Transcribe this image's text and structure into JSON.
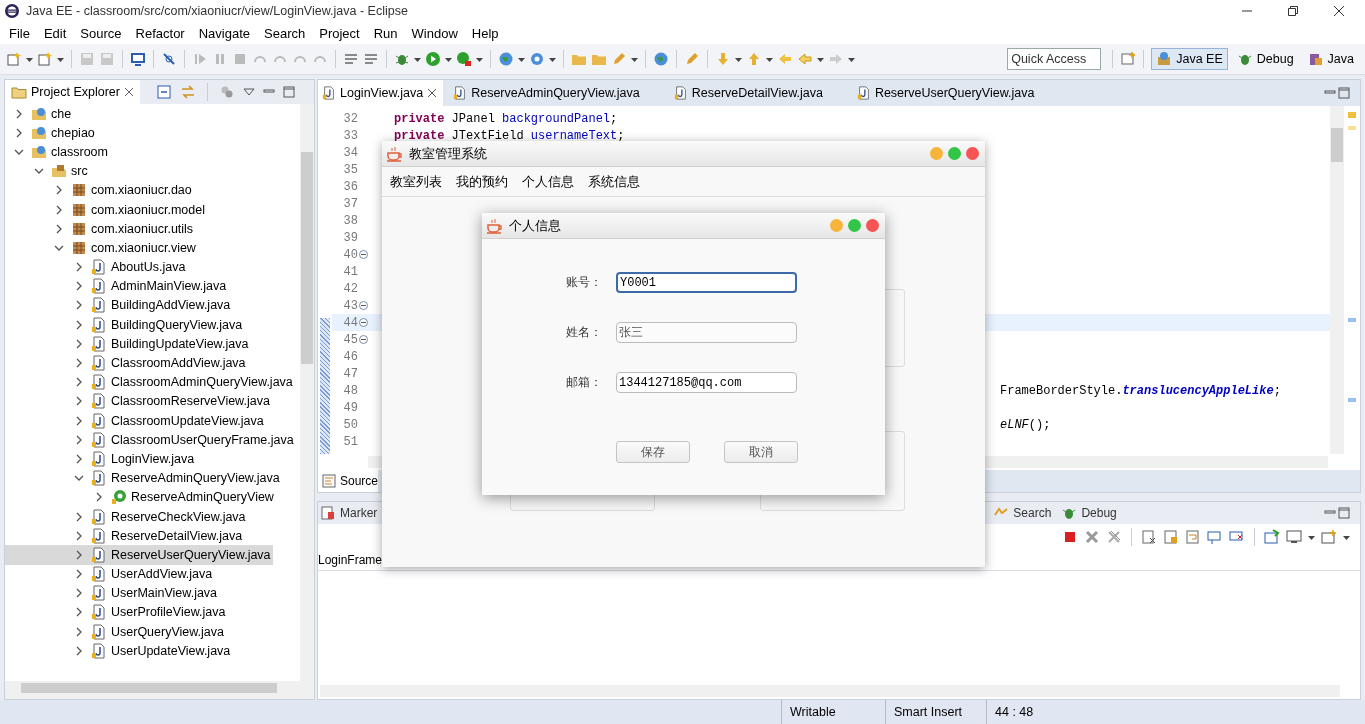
{
  "window": {
    "title": "Java EE - classroom/src/com/xiaoniucr/view/LoginView.java - Eclipse"
  },
  "menu": [
    "File",
    "Edit",
    "Source",
    "Refactor",
    "Navigate",
    "Search",
    "Project",
    "Run",
    "Window",
    "Help"
  ],
  "quick_access": {
    "placeholder": "Quick Access"
  },
  "perspectives": [
    {
      "label": "Java EE",
      "kind": "javaee",
      "selected": true
    },
    {
      "label": "Debug",
      "kind": "debug",
      "selected": false
    },
    {
      "label": "Java",
      "kind": "java",
      "selected": false
    }
  ],
  "project_explorer": {
    "title": "Project Explorer",
    "tree": [
      {
        "label": "che",
        "kind": "project",
        "expanded": false,
        "selected": false
      },
      {
        "label": "chepiao",
        "kind": "project",
        "expanded": false,
        "selected": false
      },
      {
        "label": "classroom",
        "kind": "project",
        "expanded": true,
        "selected": false,
        "children": [
          {
            "label": "src",
            "kind": "folder",
            "expanded": true,
            "selected": false,
            "children": [
              {
                "label": "com.xiaoniucr.dao",
                "kind": "package",
                "expanded": false,
                "selected": false
              },
              {
                "label": "com.xiaoniucr.model",
                "kind": "package",
                "expanded": false,
                "selected": false
              },
              {
                "label": "com.xiaoniucr.utils",
                "kind": "package",
                "expanded": false,
                "selected": false
              },
              {
                "label": "com.xiaoniucr.view",
                "kind": "package",
                "expanded": true,
                "selected": false,
                "children": [
                  {
                    "label": "AboutUs.java",
                    "kind": "file",
                    "expanded": false,
                    "selected": false
                  },
                  {
                    "label": "AdminMainView.java",
                    "kind": "file",
                    "expanded": false,
                    "selected": false
                  },
                  {
                    "label": "BuildingAddView.java",
                    "kind": "file",
                    "expanded": false,
                    "selected": false
                  },
                  {
                    "label": "BuildingQueryView.java",
                    "kind": "file",
                    "expanded": false,
                    "selected": false
                  },
                  {
                    "label": "BuildingUpdateView.java",
                    "kind": "file",
                    "expanded": false,
                    "selected": false
                  },
                  {
                    "label": "ClassroomAddView.java",
                    "kind": "file",
                    "expanded": false,
                    "selected": false
                  },
                  {
                    "label": "ClassroomAdminQueryView.java",
                    "kind": "file",
                    "expanded": false,
                    "selected": false
                  },
                  {
                    "label": "ClassroomReserveView.java",
                    "kind": "file",
                    "expanded": false,
                    "selected": false
                  },
                  {
                    "label": "ClassroomUpdateView.java",
                    "kind": "file",
                    "expanded": false,
                    "selected": false
                  },
                  {
                    "label": "ClassroomUserQueryFrame.java",
                    "kind": "file",
                    "expanded": false,
                    "selected": false
                  },
                  {
                    "label": "LoginView.java",
                    "kind": "file",
                    "expanded": false,
                    "selected": false
                  },
                  {
                    "label": "ReserveAdminQueryView.java",
                    "kind": "file",
                    "expanded": true,
                    "selected": false,
                    "children": [
                      {
                        "label": "ReserveAdminQueryView",
                        "kind": "class",
                        "expanded": false,
                        "selected": false
                      }
                    ]
                  },
                  {
                    "label": "ReserveCheckView.java",
                    "kind": "file",
                    "expanded": false,
                    "selected": false
                  },
                  {
                    "label": "ReserveDetailView.java",
                    "kind": "file",
                    "expanded": false,
                    "selected": false
                  },
                  {
                    "label": "ReserveUserQueryView.java",
                    "kind": "file",
                    "expanded": false,
                    "selected": true
                  },
                  {
                    "label": "UserAddView.java",
                    "kind": "file",
                    "expanded": false,
                    "selected": false
                  },
                  {
                    "label": "UserMainView.java",
                    "kind": "file",
                    "expanded": false,
                    "selected": false
                  },
                  {
                    "label": "UserProfileView.java",
                    "kind": "file",
                    "expanded": false,
                    "selected": false
                  },
                  {
                    "label": "UserQueryView.java",
                    "kind": "file",
                    "expanded": false,
                    "selected": false
                  },
                  {
                    "label": "UserUpdateView.java",
                    "kind": "file",
                    "expanded": false,
                    "selected": false
                  }
                ]
              }
            ]
          }
        ]
      }
    ]
  },
  "editor": {
    "tabs": [
      {
        "label": "LoginView.java",
        "selected": true
      },
      {
        "label": "ReserveAdminQueryView.java",
        "selected": false
      },
      {
        "label": "ReserveDetailView.java",
        "selected": false
      },
      {
        "label": "ReserveUserQueryView.java",
        "selected": false
      }
    ],
    "lines": [
      {
        "number": "32",
        "fold": false,
        "current": false,
        "tokens": [
          {
            "text": "private",
            "kind": "keyword"
          },
          {
            "text": " JPanel ",
            "kind": "plain"
          },
          {
            "text": "backgroundPanel",
            "kind": "field"
          },
          {
            "text": ";",
            "kind": "plain"
          }
        ]
      },
      {
        "number": "33",
        "fold": false,
        "current": false,
        "tokens": [
          {
            "text": "private",
            "kind": "keyword"
          },
          {
            "text": " JTextField ",
            "kind": "plain"
          },
          {
            "text": "usernameText",
            "kind": "field"
          },
          {
            "text": ";",
            "kind": "plain"
          }
        ]
      },
      {
        "number": "34",
        "fold": false,
        "current": false
      },
      {
        "number": "35",
        "fold": false,
        "current": false
      },
      {
        "number": "36",
        "fold": false,
        "current": false
      },
      {
        "number": "37",
        "fold": false,
        "current": false
      },
      {
        "number": "38",
        "fold": false,
        "current": false
      },
      {
        "number": "39",
        "fold": false,
        "current": false
      },
      {
        "number": "40",
        "fold": true,
        "current": false
      },
      {
        "number": "41",
        "fold": false,
        "current": false
      },
      {
        "number": "42",
        "fold": false,
        "current": false
      },
      {
        "number": "43",
        "fold": true,
        "current": false
      },
      {
        "number": "44",
        "fold": true,
        "current": true
      },
      {
        "number": "45",
        "fold": true,
        "current": false
      },
      {
        "number": "46",
        "fold": false,
        "current": false
      },
      {
        "number": "47",
        "fold": false,
        "current": false
      },
      {
        "number": "48",
        "fold": false,
        "current": false,
        "tail": true,
        "tokens": [
          {
            "text": "FrameBorderStyle.",
            "kind": "plain"
          },
          {
            "text": "translucencyAppleLike",
            "kind": "static"
          },
          {
            "text": ";",
            "kind": "plain"
          }
        ]
      },
      {
        "number": "49",
        "fold": false,
        "current": false
      },
      {
        "number": "50",
        "fold": false,
        "current": false,
        "tail": true,
        "tokens": [
          {
            "text": "eLNF",
            "kind": "method"
          },
          {
            "text": "();",
            "kind": "plain"
          }
        ]
      },
      {
        "number": "51",
        "fold": false,
        "current": false
      }
    ],
    "bottom_tabs": [
      {
        "label": "Source",
        "selected": true
      }
    ]
  },
  "bottom_panel": {
    "tabs": [
      {
        "label": "Marker",
        "kind": "markers",
        "selected": false
      },
      {
        "label": "Search",
        "kind": "search",
        "selected": false
      },
      {
        "label": "Debug",
        "kind": "debug",
        "selected": false
      }
    ],
    "console_header": "LoginFrame"
  },
  "status_bar": [
    "Writable",
    "Smart Insert",
    "44 : 48"
  ],
  "app_window": {
    "title": "教室管理系统",
    "menu": [
      "教室列表",
      "我的预约",
      "个人信息",
      "系统信息"
    ],
    "dialog": {
      "title": "个人信息",
      "fields": [
        {
          "label": "账号：",
          "value": "Y0001",
          "focused": true,
          "disabled": false
        },
        {
          "label": "姓名：",
          "value": "张三",
          "focused": false,
          "disabled": true
        },
        {
          "label": "邮箱：",
          "value": "1344127185@qq.com",
          "focused": false,
          "disabled": false
        }
      ],
      "buttons": [
        "保存",
        "取消"
      ]
    }
  }
}
